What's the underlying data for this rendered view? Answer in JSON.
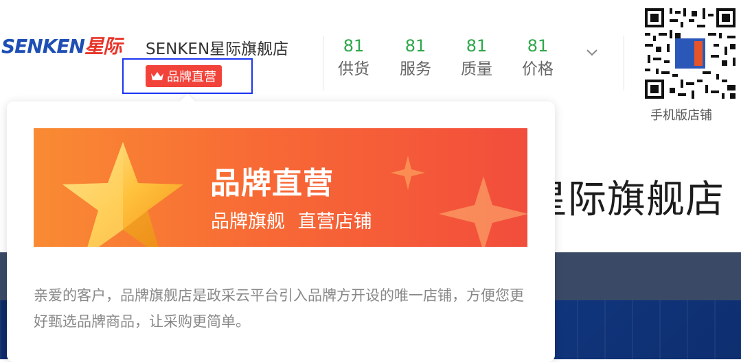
{
  "header": {
    "logo": {
      "en": "SENKEN",
      "zh": "星际"
    },
    "store_name": "SENKEN星际旗舰店",
    "badge_label": "品牌直营",
    "scores": [
      {
        "value": "81",
        "label": "供货"
      },
      {
        "value": "81",
        "label": "服务"
      },
      {
        "value": "81",
        "label": "质量"
      },
      {
        "value": "81",
        "label": "价格"
      }
    ],
    "qr_caption": "手机版店铺"
  },
  "popup": {
    "banner_title": "品牌直营",
    "banner_subtitle": "品牌旗舰 直营店铺",
    "description": "亲爱的客户，品牌旗舰店是政采云平台引入品牌方开设的唯一店铺，方便您更好甄选品牌商品，让采购更简单。"
  },
  "background": {
    "banner_text": "星际旗舰店"
  },
  "colors": {
    "badge_red": "#f2433a",
    "score_green": "#2da84a",
    "highlight_box": "#1a34f0",
    "banner_orange": "#f86a35"
  }
}
